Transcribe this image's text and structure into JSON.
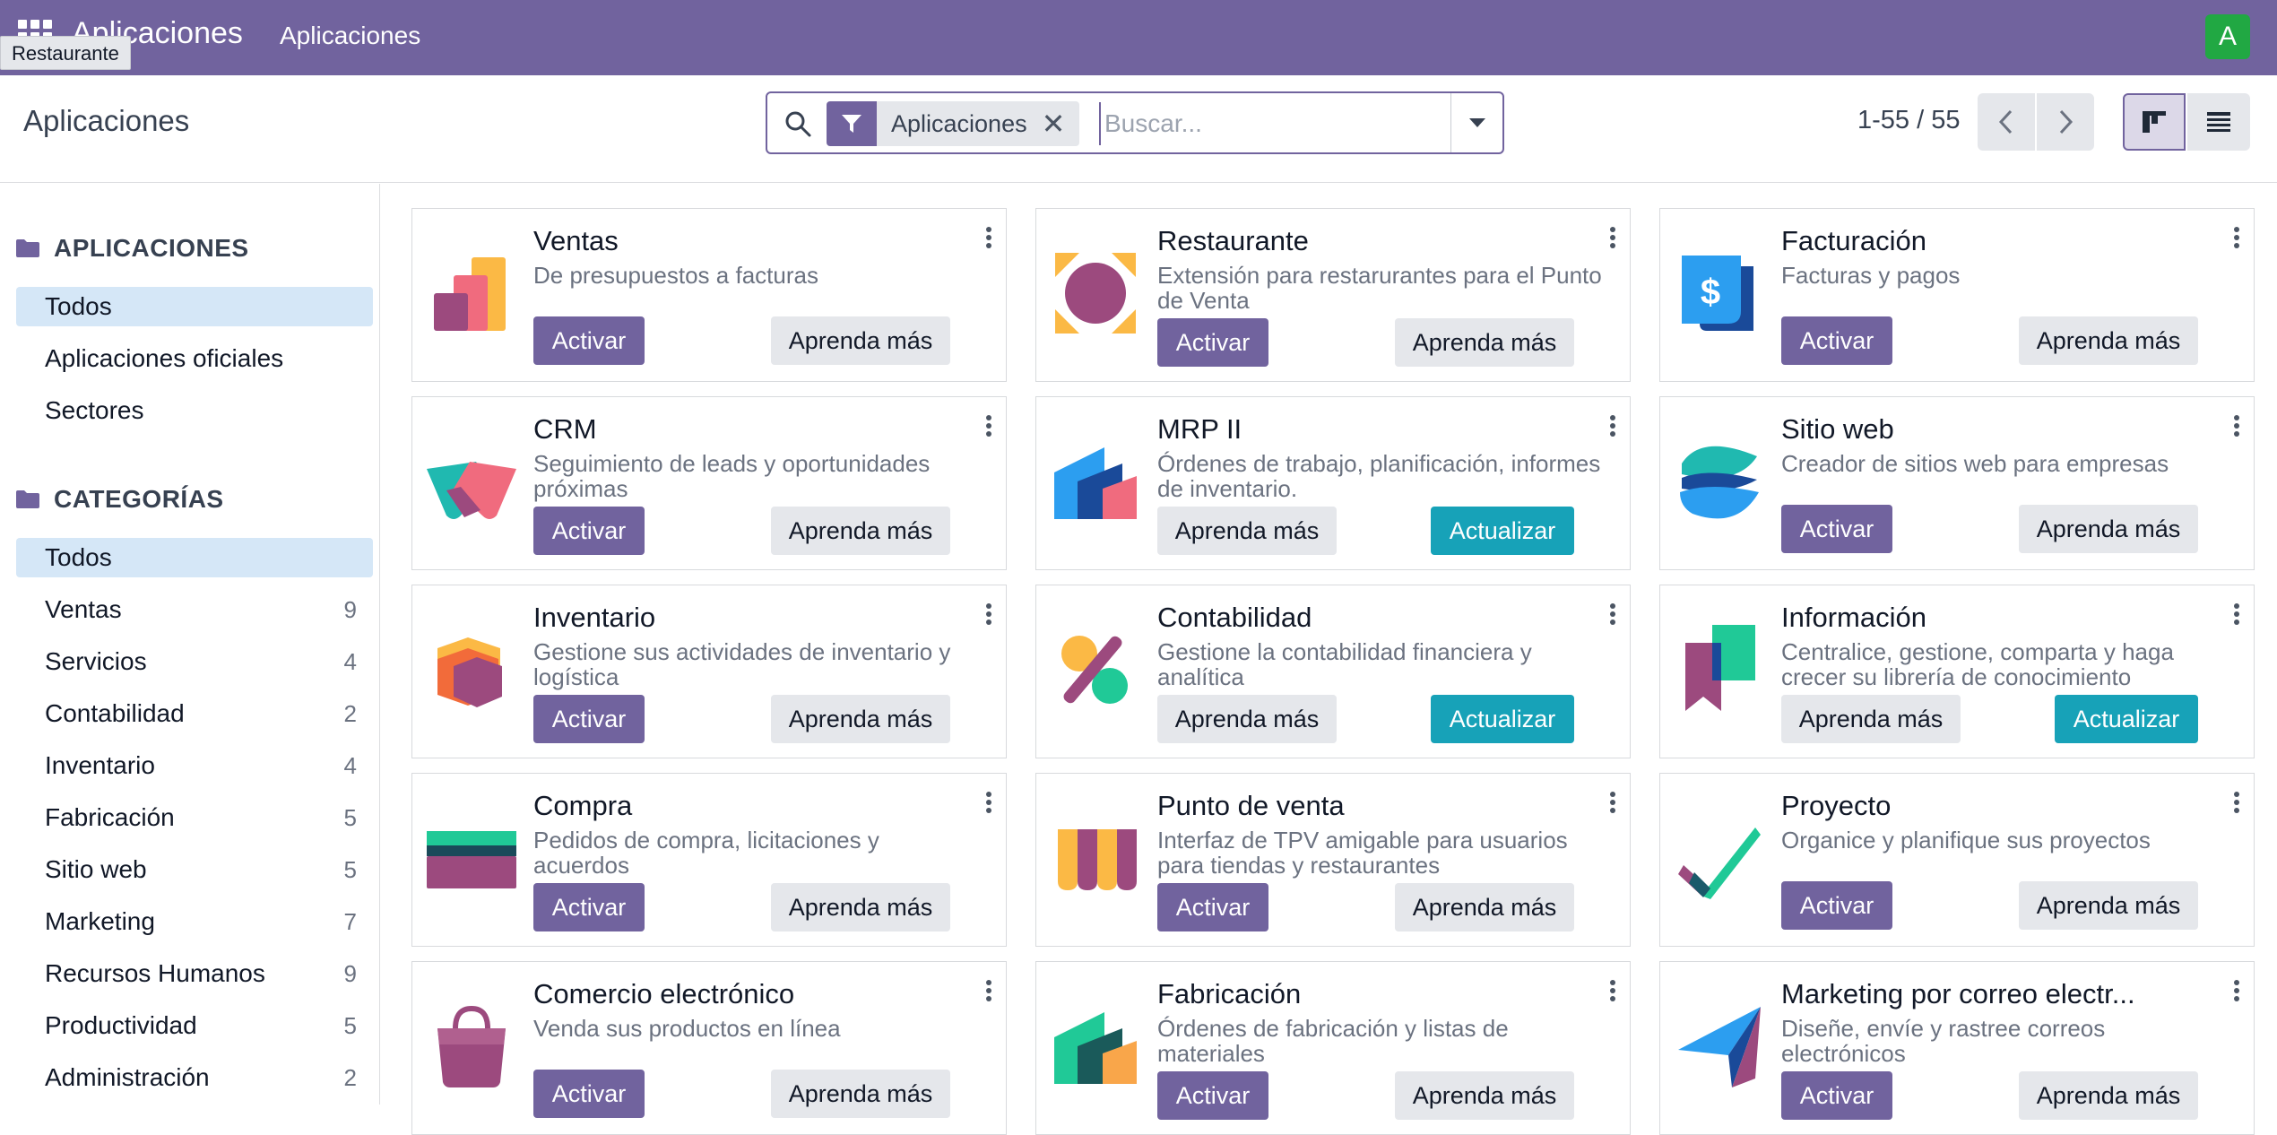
{
  "navbar": {
    "brand": "Aplicaciones",
    "menu": "Aplicaciones",
    "tooltip": "Restaurante",
    "user_initial": "A"
  },
  "control": {
    "title": "Aplicaciones",
    "facet_label": "Aplicaciones",
    "facet_close": "✕",
    "search_placeholder": "Buscar...",
    "pager_text": "1-55 / 55"
  },
  "sidebar": {
    "apps_heading": "APLICACIONES",
    "apps_items": [
      {
        "label": "Todos",
        "active": true
      },
      {
        "label": "Aplicaciones oficiales"
      },
      {
        "label": "Sectores"
      }
    ],
    "categories_heading": "CATEGORÍAS",
    "categories": [
      {
        "label": "Todos",
        "count": "",
        "active": true
      },
      {
        "label": "Ventas",
        "count": "9"
      },
      {
        "label": "Servicios",
        "count": "4"
      },
      {
        "label": "Contabilidad",
        "count": "2"
      },
      {
        "label": "Inventario",
        "count": "4"
      },
      {
        "label": "Fabricación",
        "count": "5"
      },
      {
        "label": "Sitio web",
        "count": "5"
      },
      {
        "label": "Marketing",
        "count": "7"
      },
      {
        "label": "Recursos Humanos",
        "count": "9"
      },
      {
        "label": "Productividad",
        "count": "5"
      },
      {
        "label": "Administración",
        "count": "2"
      }
    ]
  },
  "apps": [
    {
      "name": "Ventas",
      "summary": "De presupuestos a facturas",
      "primary": "Activar",
      "secondary": "Aprenda más",
      "icon": "sales-icon"
    },
    {
      "name": "Restaurante",
      "summary": "Extensión para restarurantes para el Punto de Venta",
      "primary": "Activar",
      "secondary": "Aprenda más",
      "icon": "restaurant-icon"
    },
    {
      "name": "Facturación",
      "summary": "Facturas y pagos",
      "primary": "Activar",
      "secondary": "Aprenda más",
      "icon": "invoicing-icon"
    },
    {
      "name": "CRM",
      "summary": "Seguimiento de leads y oportunidades próximas",
      "primary": "Activar",
      "secondary": "Aprenda más",
      "icon": "crm-icon"
    },
    {
      "name": "MRP II",
      "summary": "Órdenes de trabajo, planificación, informes de inventario.",
      "primary": "Aprenda más",
      "secondary": "Actualizar",
      "icon": "mrp-icon",
      "installed": true
    },
    {
      "name": "Sitio web",
      "summary": "Creador de sitios web para empresas",
      "primary": "Activar",
      "secondary": "Aprenda más",
      "icon": "website-icon"
    },
    {
      "name": "Inventario",
      "summary": "Gestione sus actividades de inventario y logística",
      "primary": "Activar",
      "secondary": "Aprenda más",
      "icon": "inventory-icon"
    },
    {
      "name": "Contabilidad",
      "summary": "Gestione la contabilidad financiera y analítica",
      "primary": "Aprenda más",
      "secondary": "Actualizar",
      "icon": "accounting-icon",
      "installed": true
    },
    {
      "name": "Información",
      "summary": "Centralice, gestione, comparta y haga crecer su librería de conocimiento",
      "primary": "Aprenda más",
      "secondary": "Actualizar",
      "icon": "knowledge-icon",
      "installed": true
    },
    {
      "name": "Compra",
      "summary": "Pedidos de compra, licitaciones y acuerdos",
      "primary": "Activar",
      "secondary": "Aprenda más",
      "icon": "purchase-icon"
    },
    {
      "name": "Punto de venta",
      "summary": "Interfaz de TPV amigable para usuarios para tiendas y restaurantes",
      "primary": "Activar",
      "secondary": "Aprenda más",
      "icon": "pos-icon"
    },
    {
      "name": "Proyecto",
      "summary": "Organice y planifique sus proyectos",
      "primary": "Activar",
      "secondary": "Aprenda más",
      "icon": "project-icon"
    },
    {
      "name": "Comercio electrónico",
      "summary": "Venda sus productos en línea",
      "primary": "Activar",
      "secondary": "Aprenda más",
      "icon": "ecommerce-icon"
    },
    {
      "name": "Fabricación",
      "summary": "Órdenes de fabricación y listas de materiales",
      "primary": "Activar",
      "secondary": "Aprenda más",
      "icon": "manufacturing-icon"
    },
    {
      "name": "Marketing por correo electr...",
      "summary": "Diseñe, envíe y rastree correos electrónicos",
      "primary": "Activar",
      "secondary": "Aprenda más",
      "icon": "email-marketing-icon"
    }
  ],
  "colors": {
    "brand": "#71639e",
    "update": "#17a2b8",
    "active_filter": "#d5e7f7"
  }
}
